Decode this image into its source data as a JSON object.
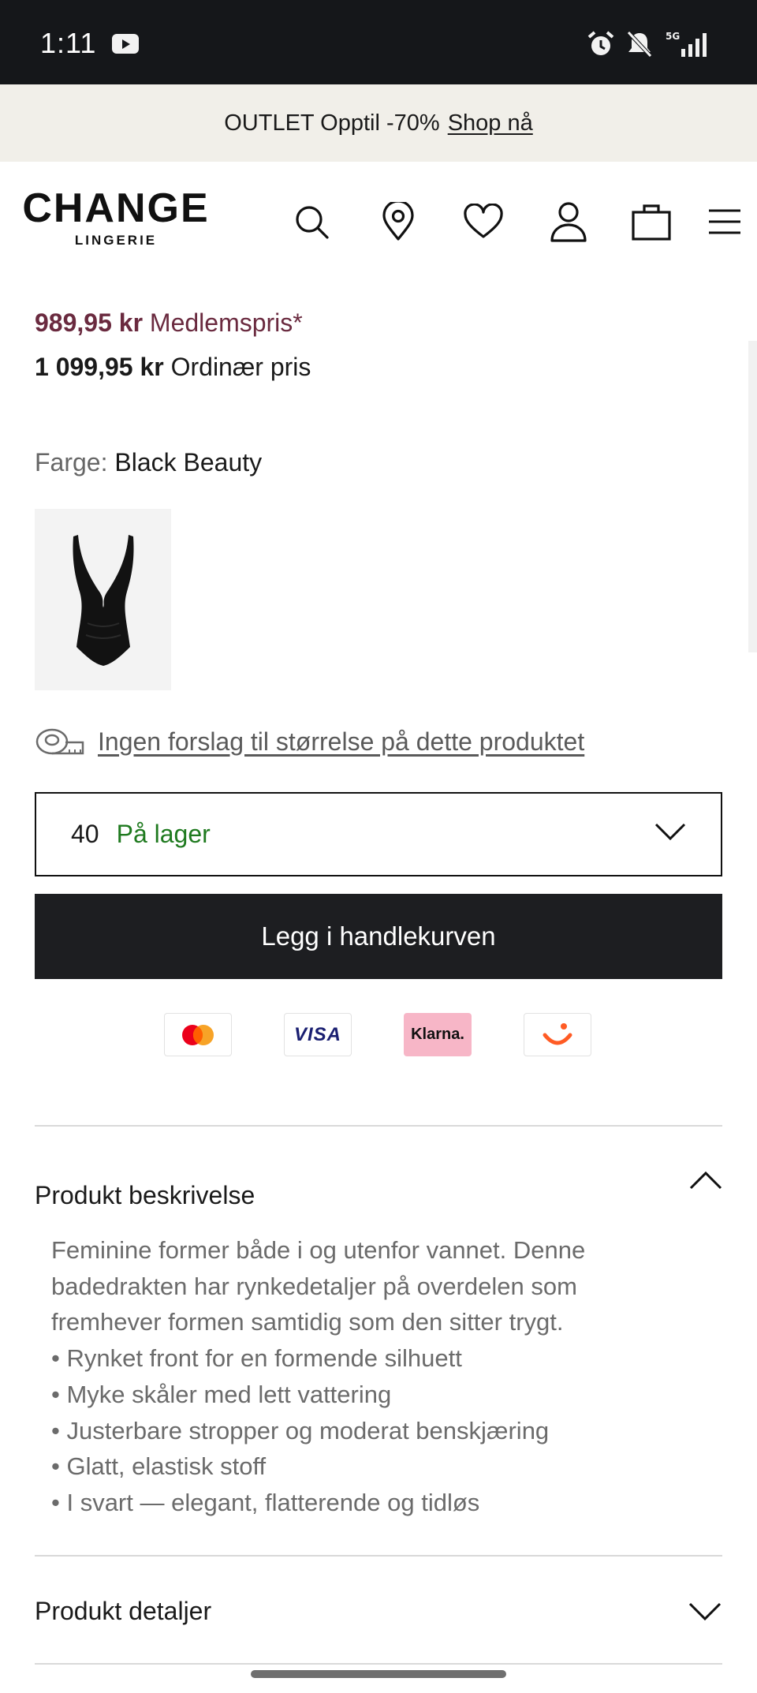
{
  "status_bar": {
    "time": "1:11",
    "icons": [
      "youtube-icon",
      "alarm-icon",
      "mute-icon",
      "signal-5g-icon"
    ]
  },
  "promo": {
    "text": "OUTLET Opptil -70%",
    "link": "Shop nå"
  },
  "header": {
    "logo_main": "CHANGE",
    "logo_sub": "LINGERIE",
    "icons": [
      "search-icon",
      "store-locator-icon",
      "wishlist-icon",
      "account-icon",
      "cart-icon",
      "menu-icon"
    ]
  },
  "product": {
    "member_price_amount": "989,95 kr",
    "member_price_label": "Medlemspris*",
    "ordinary_price_amount": "1 099,95 kr",
    "ordinary_price_label": "Ordinær pris",
    "color_label": "Farge:",
    "color_value": "Black Beauty",
    "size_hint": "Ingen forslag til størrelse på dette produktet",
    "selected_size": "40",
    "stock_status": "På lager",
    "add_to_cart": "Legg i handlekurven",
    "payments": [
      "Mastercard",
      "VISA",
      "Klarna.",
      "Vipps"
    ],
    "accent_color": "#6a2a3f",
    "stock_color": "#1f7a1f"
  },
  "accordion": {
    "description_title": "Produkt beskrivelse",
    "description_lines": [
      "Feminine former både i og utenfor vannet. Denne",
      "badedrakten har rynkedetaljer på overdelen som",
      "fremhever formen samtidig som den sitter trygt.",
      "• Rynket front for en formende silhuett",
      "• Myke skåler med lett vattering",
      "• Justerbare stropper og moderat benskjæring",
      "• Glatt, elastisk stoff",
      "• I svart — elegant, flatterende og tidløs"
    ],
    "details_title": "Produkt detaljer"
  }
}
